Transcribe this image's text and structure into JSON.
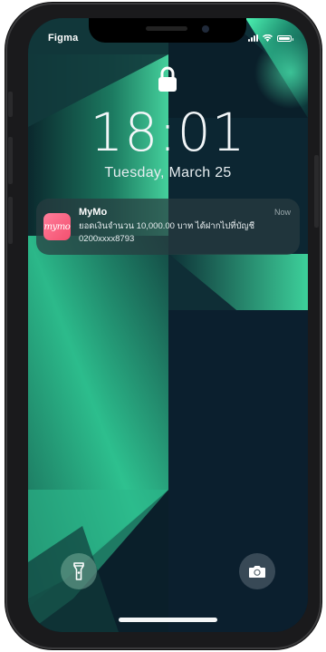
{
  "status_bar": {
    "carrier": "Figma"
  },
  "lock_screen": {
    "time": "18:01",
    "date": "Tuesday, March 25"
  },
  "notification": {
    "app_name": "MyMo",
    "app_icon_label": "mymo",
    "timestamp": "Now",
    "body_line1": "ยอดเงินจำนวน 10,000.00 บาท ได้ฝากไปที่บัญชี",
    "body_line2": "0200xxxx8793"
  },
  "quick_actions": {
    "left": "flashlight-icon",
    "right": "camera-icon"
  },
  "colors": {
    "wallpaper_dark": "#0a1f2a",
    "wallpaper_green": "#3fe8a0",
    "app_icon": "#f4506f"
  }
}
